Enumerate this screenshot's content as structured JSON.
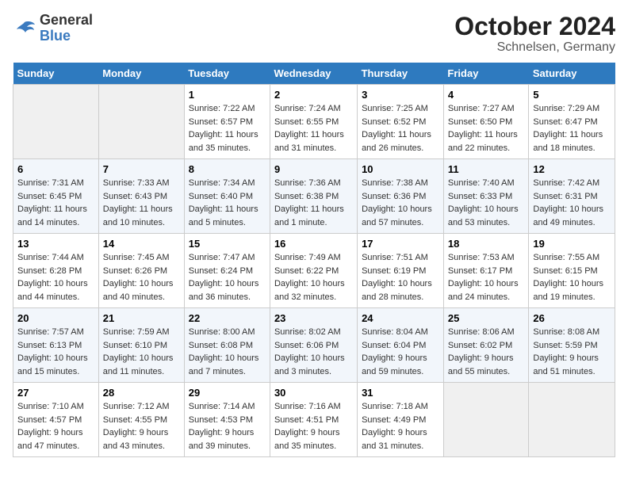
{
  "header": {
    "logo": {
      "line1": "General",
      "line2": "Blue"
    },
    "title": "October 2024",
    "subtitle": "Schnelsen, Germany"
  },
  "weekdays": [
    "Sunday",
    "Monday",
    "Tuesday",
    "Wednesday",
    "Thursday",
    "Friday",
    "Saturday"
  ],
  "weeks": [
    [
      {
        "day": "",
        "empty": true
      },
      {
        "day": "",
        "empty": true
      },
      {
        "day": "1",
        "sunrise": "7:22 AM",
        "sunset": "6:57 PM",
        "daylight": "11 hours and 35 minutes."
      },
      {
        "day": "2",
        "sunrise": "7:24 AM",
        "sunset": "6:55 PM",
        "daylight": "11 hours and 31 minutes."
      },
      {
        "day": "3",
        "sunrise": "7:25 AM",
        "sunset": "6:52 PM",
        "daylight": "11 hours and 26 minutes."
      },
      {
        "day": "4",
        "sunrise": "7:27 AM",
        "sunset": "6:50 PM",
        "daylight": "11 hours and 22 minutes."
      },
      {
        "day": "5",
        "sunrise": "7:29 AM",
        "sunset": "6:47 PM",
        "daylight": "11 hours and 18 minutes."
      }
    ],
    [
      {
        "day": "6",
        "sunrise": "7:31 AM",
        "sunset": "6:45 PM",
        "daylight": "11 hours and 14 minutes."
      },
      {
        "day": "7",
        "sunrise": "7:33 AM",
        "sunset": "6:43 PM",
        "daylight": "11 hours and 10 minutes."
      },
      {
        "day": "8",
        "sunrise": "7:34 AM",
        "sunset": "6:40 PM",
        "daylight": "11 hours and 5 minutes."
      },
      {
        "day": "9",
        "sunrise": "7:36 AM",
        "sunset": "6:38 PM",
        "daylight": "11 hours and 1 minute."
      },
      {
        "day": "10",
        "sunrise": "7:38 AM",
        "sunset": "6:36 PM",
        "daylight": "10 hours and 57 minutes."
      },
      {
        "day": "11",
        "sunrise": "7:40 AM",
        "sunset": "6:33 PM",
        "daylight": "10 hours and 53 minutes."
      },
      {
        "day": "12",
        "sunrise": "7:42 AM",
        "sunset": "6:31 PM",
        "daylight": "10 hours and 49 minutes."
      }
    ],
    [
      {
        "day": "13",
        "sunrise": "7:44 AM",
        "sunset": "6:28 PM",
        "daylight": "10 hours and 44 minutes."
      },
      {
        "day": "14",
        "sunrise": "7:45 AM",
        "sunset": "6:26 PM",
        "daylight": "10 hours and 40 minutes."
      },
      {
        "day": "15",
        "sunrise": "7:47 AM",
        "sunset": "6:24 PM",
        "daylight": "10 hours and 36 minutes."
      },
      {
        "day": "16",
        "sunrise": "7:49 AM",
        "sunset": "6:22 PM",
        "daylight": "10 hours and 32 minutes."
      },
      {
        "day": "17",
        "sunrise": "7:51 AM",
        "sunset": "6:19 PM",
        "daylight": "10 hours and 28 minutes."
      },
      {
        "day": "18",
        "sunrise": "7:53 AM",
        "sunset": "6:17 PM",
        "daylight": "10 hours and 24 minutes."
      },
      {
        "day": "19",
        "sunrise": "7:55 AM",
        "sunset": "6:15 PM",
        "daylight": "10 hours and 19 minutes."
      }
    ],
    [
      {
        "day": "20",
        "sunrise": "7:57 AM",
        "sunset": "6:13 PM",
        "daylight": "10 hours and 15 minutes."
      },
      {
        "day": "21",
        "sunrise": "7:59 AM",
        "sunset": "6:10 PM",
        "daylight": "10 hours and 11 minutes."
      },
      {
        "day": "22",
        "sunrise": "8:00 AM",
        "sunset": "6:08 PM",
        "daylight": "10 hours and 7 minutes."
      },
      {
        "day": "23",
        "sunrise": "8:02 AM",
        "sunset": "6:06 PM",
        "daylight": "10 hours and 3 minutes."
      },
      {
        "day": "24",
        "sunrise": "8:04 AM",
        "sunset": "6:04 PM",
        "daylight": "9 hours and 59 minutes."
      },
      {
        "day": "25",
        "sunrise": "8:06 AM",
        "sunset": "6:02 PM",
        "daylight": "9 hours and 55 minutes."
      },
      {
        "day": "26",
        "sunrise": "8:08 AM",
        "sunset": "5:59 PM",
        "daylight": "9 hours and 51 minutes."
      }
    ],
    [
      {
        "day": "27",
        "sunrise": "7:10 AM",
        "sunset": "4:57 PM",
        "daylight": "9 hours and 47 minutes."
      },
      {
        "day": "28",
        "sunrise": "7:12 AM",
        "sunset": "4:55 PM",
        "daylight": "9 hours and 43 minutes."
      },
      {
        "day": "29",
        "sunrise": "7:14 AM",
        "sunset": "4:53 PM",
        "daylight": "9 hours and 39 minutes."
      },
      {
        "day": "30",
        "sunrise": "7:16 AM",
        "sunset": "4:51 PM",
        "daylight": "9 hours and 35 minutes."
      },
      {
        "day": "31",
        "sunrise": "7:18 AM",
        "sunset": "4:49 PM",
        "daylight": "9 hours and 31 minutes."
      },
      {
        "day": "",
        "empty": true
      },
      {
        "day": "",
        "empty": true
      }
    ]
  ],
  "labels": {
    "sunrise": "Sunrise:",
    "sunset": "Sunset:",
    "daylight": "Daylight:"
  }
}
